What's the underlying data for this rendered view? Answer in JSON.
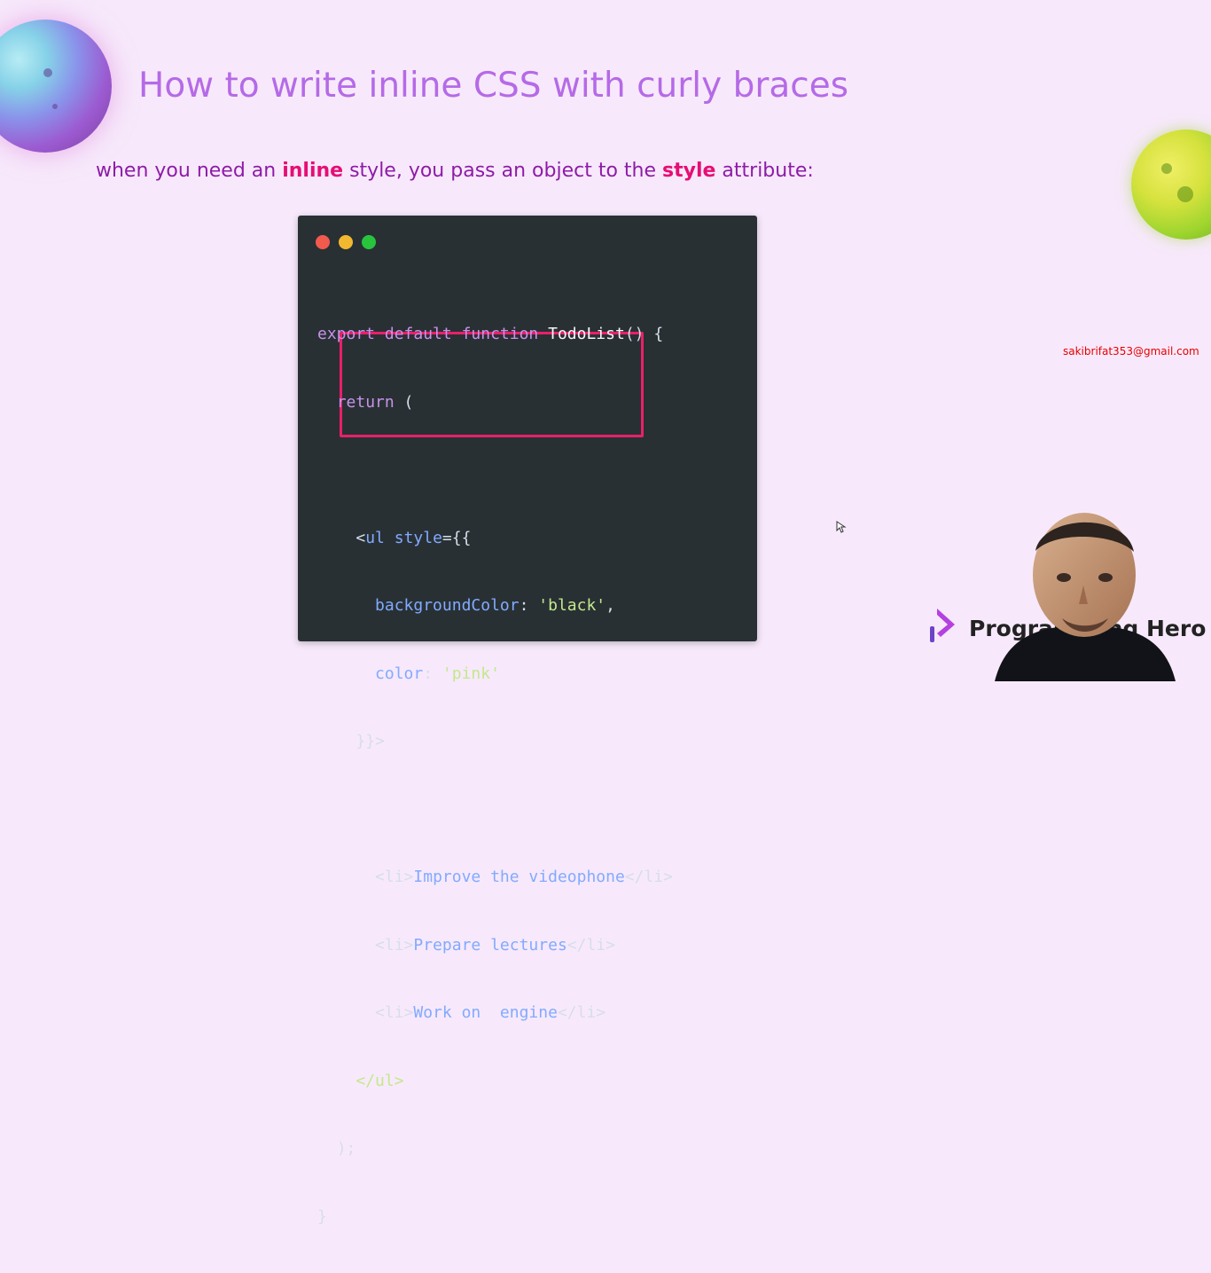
{
  "slide": {
    "title": "How to write inline CSS with curly braces",
    "subtitle": {
      "before": "when you need an ",
      "highlight1": "inline",
      "middle": " style, you pass an object to the ",
      "highlight2": "style",
      "after": " attribute:"
    },
    "code": {
      "line1": {
        "kw1": "export",
        "kw2": "default",
        "kw3": "function",
        "name": "TodoList",
        "rest": "() {"
      },
      "line2": {
        "kw": "return",
        "rest": " ("
      },
      "line3": {
        "open": "<",
        "tag": "ul",
        "attr": "style",
        "rest": "={{"
      },
      "line4": {
        "prop": "backgroundColor",
        "sep": ": ",
        "val": "'black'",
        "end": ","
      },
      "line5": {
        "prop": "color",
        "sep": ": ",
        "val": "'pink'"
      },
      "line6": "}}>",
      "line7": {
        "open": "<li>",
        "text": "Improve the videophone",
        "close": "</li>"
      },
      "line8": {
        "open": "<li>",
        "text": "Prepare lectures",
        "close": "</li>"
      },
      "line9": {
        "open": "<li>",
        "text": "Work on  engine",
        "close": "</li>"
      },
      "line10": "</ul>",
      "line11": ");",
      "line12": "}"
    },
    "email": "sakibrifat353@gmail.com",
    "brand": {
      "text": "Programming Hero"
    }
  },
  "icons": {
    "window_dots": [
      "close-dot-icon",
      "minimize-dot-icon",
      "maximize-dot-icon"
    ],
    "planet_left": "planet-icon",
    "planet_right": "planet-icon",
    "cursor": "cursor-icon",
    "brand": "programming-hero-logo-icon"
  },
  "colors": {
    "background": "#f7e9fb",
    "title": "#b56ae7",
    "subtitle": "#8e1ba8",
    "highlight": "#e60e74",
    "code_bg": "#283034",
    "box": "#ea1f69",
    "email": "#e60000"
  }
}
